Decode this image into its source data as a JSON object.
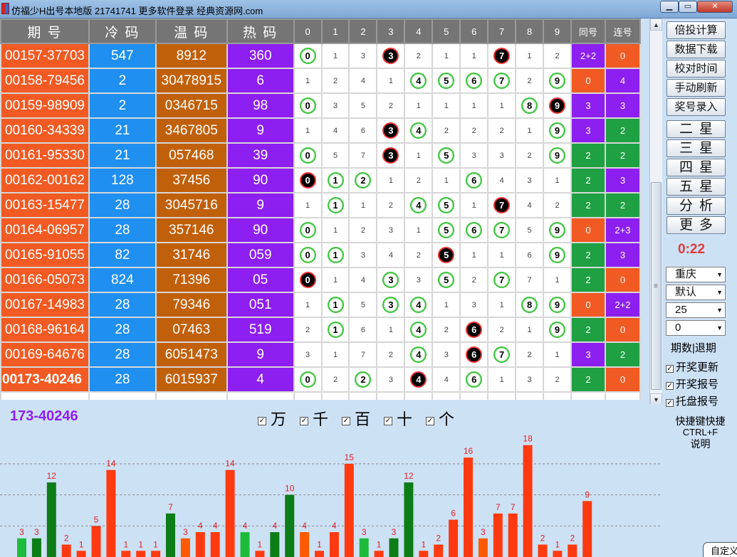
{
  "window": {
    "title": "仿福少H出号本地版 21741741 更多软件登录 经典资源网.com",
    "minimize": "▁",
    "maximize": "▭",
    "close": "✕"
  },
  "table": {
    "headers": [
      "期 号",
      "冷 码",
      "温 码",
      "热 码",
      "0",
      "1",
      "2",
      "3",
      "4",
      "5",
      "6",
      "7",
      "8",
      "9",
      "同号",
      "连号"
    ],
    "rows": [
      {
        "issue": "00157-37703",
        "cold": "547",
        "warm": "8912",
        "hot": "360",
        "digits": [
          {
            "v": "0",
            "s": "g"
          },
          {
            "v": "1"
          },
          {
            "v": "3"
          },
          {
            "v": "3",
            "s": "b"
          },
          {
            "v": "2"
          },
          {
            "v": "1"
          },
          {
            "v": "1"
          },
          {
            "v": "7",
            "s": "b"
          },
          {
            "v": "1"
          },
          {
            "v": "2"
          }
        ],
        "same": "2+2",
        "same_color": "purple",
        "cons": "0",
        "cons_color": "orange"
      },
      {
        "issue": "00158-79456",
        "cold": "2",
        "warm": "30478915",
        "hot": "6",
        "digits": [
          {
            "v": "1"
          },
          {
            "v": "2"
          },
          {
            "v": "4"
          },
          {
            "v": "1"
          },
          {
            "v": "4",
            "s": "g"
          },
          {
            "v": "5",
            "s": "g"
          },
          {
            "v": "6",
            "s": "g"
          },
          {
            "v": "7",
            "s": "g"
          },
          {
            "v": "2"
          },
          {
            "v": "9",
            "s": "g"
          }
        ],
        "same": "0",
        "same_color": "orange",
        "cons": "4",
        "cons_color": "purple"
      },
      {
        "issue": "00159-98909",
        "cold": "2",
        "warm": "0346715",
        "hot": "98",
        "digits": [
          {
            "v": "0",
            "s": "g"
          },
          {
            "v": "3"
          },
          {
            "v": "5"
          },
          {
            "v": "2"
          },
          {
            "v": "1"
          },
          {
            "v": "1"
          },
          {
            "v": "1"
          },
          {
            "v": "1"
          },
          {
            "v": "8",
            "s": "g"
          },
          {
            "v": "9",
            "s": "b"
          }
        ],
        "same": "3",
        "same_color": "purple",
        "cons": "3",
        "cons_color": "purple"
      },
      {
        "issue": "00160-34339",
        "cold": "21",
        "warm": "3467805",
        "hot": "9",
        "digits": [
          {
            "v": "1"
          },
          {
            "v": "4"
          },
          {
            "v": "6"
          },
          {
            "v": "3",
            "s": "b"
          },
          {
            "v": "4",
            "s": "g"
          },
          {
            "v": "2"
          },
          {
            "v": "2"
          },
          {
            "v": "2"
          },
          {
            "v": "1"
          },
          {
            "v": "9",
            "s": "g"
          }
        ],
        "same": "3",
        "same_color": "purple",
        "cons": "2",
        "cons_color": "green"
      },
      {
        "issue": "00161-95330",
        "cold": "21",
        "warm": "057468",
        "hot": "39",
        "digits": [
          {
            "v": "0",
            "s": "g"
          },
          {
            "v": "5"
          },
          {
            "v": "7"
          },
          {
            "v": "3",
            "s": "b"
          },
          {
            "v": "1"
          },
          {
            "v": "5",
            "s": "g"
          },
          {
            "v": "3"
          },
          {
            "v": "3"
          },
          {
            "v": "2"
          },
          {
            "v": "9",
            "s": "g"
          }
        ],
        "same": "2",
        "same_color": "green",
        "cons": "2",
        "cons_color": "green"
      },
      {
        "issue": "00162-00162",
        "cold": "128",
        "warm": "37456",
        "hot": "90",
        "digits": [
          {
            "v": "0",
            "s": "b"
          },
          {
            "v": "1",
            "s": "g"
          },
          {
            "v": "2",
            "s": "g"
          },
          {
            "v": "1"
          },
          {
            "v": "2"
          },
          {
            "v": "1"
          },
          {
            "v": "6",
            "s": "g"
          },
          {
            "v": "4"
          },
          {
            "v": "3"
          },
          {
            "v": "1"
          }
        ],
        "same": "2",
        "same_color": "green",
        "cons": "3",
        "cons_color": "purple"
      },
      {
        "issue": "00163-15477",
        "cold": "28",
        "warm": "3045716",
        "hot": "9",
        "digits": [
          {
            "v": "1"
          },
          {
            "v": "1",
            "s": "g"
          },
          {
            "v": "1"
          },
          {
            "v": "2"
          },
          {
            "v": "4",
            "s": "g"
          },
          {
            "v": "5",
            "s": "g"
          },
          {
            "v": "1"
          },
          {
            "v": "7",
            "s": "b"
          },
          {
            "v": "4"
          },
          {
            "v": "2"
          }
        ],
        "same": "2",
        "same_color": "green",
        "cons": "2",
        "cons_color": "green"
      },
      {
        "issue": "00164-06957",
        "cold": "28",
        "warm": "357146",
        "hot": "90",
        "digits": [
          {
            "v": "0",
            "s": "g"
          },
          {
            "v": "1"
          },
          {
            "v": "2"
          },
          {
            "v": "3"
          },
          {
            "v": "1"
          },
          {
            "v": "5",
            "s": "g"
          },
          {
            "v": "6",
            "s": "g"
          },
          {
            "v": "7",
            "s": "g"
          },
          {
            "v": "5"
          },
          {
            "v": "9",
            "s": "g"
          }
        ],
        "same": "0",
        "same_color": "orange",
        "cons": "2+3",
        "cons_color": "purple"
      },
      {
        "issue": "00165-91055",
        "cold": "82",
        "warm": "31746",
        "hot": "059",
        "digits": [
          {
            "v": "0",
            "s": "g"
          },
          {
            "v": "1",
            "s": "g"
          },
          {
            "v": "3"
          },
          {
            "v": "4"
          },
          {
            "v": "2"
          },
          {
            "v": "5",
            "s": "b"
          },
          {
            "v": "1"
          },
          {
            "v": "1"
          },
          {
            "v": "6"
          },
          {
            "v": "9",
            "s": "g"
          }
        ],
        "same": "2",
        "same_color": "green",
        "cons": "3",
        "cons_color": "purple"
      },
      {
        "issue": "00166-05073",
        "cold": "824",
        "warm": "71396",
        "hot": "05",
        "digits": [
          {
            "v": "0",
            "s": "b"
          },
          {
            "v": "1"
          },
          {
            "v": "4"
          },
          {
            "v": "3",
            "s": "g"
          },
          {
            "v": "3"
          },
          {
            "v": "5",
            "s": "g"
          },
          {
            "v": "2"
          },
          {
            "v": "7",
            "s": "g"
          },
          {
            "v": "7"
          },
          {
            "v": "1"
          }
        ],
        "same": "2",
        "same_color": "green",
        "cons": "0",
        "cons_color": "orange"
      },
      {
        "issue": "00167-14983",
        "cold": "28",
        "warm": "79346",
        "hot": "051",
        "digits": [
          {
            "v": "1"
          },
          {
            "v": "1",
            "s": "g"
          },
          {
            "v": "5"
          },
          {
            "v": "3",
            "s": "g"
          },
          {
            "v": "4",
            "s": "g"
          },
          {
            "v": "1"
          },
          {
            "v": "3"
          },
          {
            "v": "1"
          },
          {
            "v": "8",
            "s": "g"
          },
          {
            "v": "9",
            "s": "g"
          }
        ],
        "same": "0",
        "same_color": "orange",
        "cons": "2+2",
        "cons_color": "purple"
      },
      {
        "issue": "00168-96164",
        "cold": "28",
        "warm": "07463",
        "hot": "519",
        "digits": [
          {
            "v": "2"
          },
          {
            "v": "1",
            "s": "g"
          },
          {
            "v": "6"
          },
          {
            "v": "1"
          },
          {
            "v": "4",
            "s": "g"
          },
          {
            "v": "2"
          },
          {
            "v": "6",
            "s": "b"
          },
          {
            "v": "2"
          },
          {
            "v": "1"
          },
          {
            "v": "9",
            "s": "g"
          }
        ],
        "same": "2",
        "same_color": "green",
        "cons": "0",
        "cons_color": "orange"
      },
      {
        "issue": "00169-64676",
        "cold": "28",
        "warm": "6051473",
        "hot": "9",
        "digits": [
          {
            "v": "3"
          },
          {
            "v": "1"
          },
          {
            "v": "7"
          },
          {
            "v": "2"
          },
          {
            "v": "4",
            "s": "g"
          },
          {
            "v": "3"
          },
          {
            "v": "6",
            "s": "b"
          },
          {
            "v": "7",
            "s": "g"
          },
          {
            "v": "2"
          },
          {
            "v": "1"
          }
        ],
        "same": "3",
        "same_color": "purple",
        "cons": "2",
        "cons_color": "green"
      },
      {
        "issue": "00173-40246",
        "cold": "28",
        "warm": "6015937",
        "hot": "4",
        "digits": [
          {
            "v": "0",
            "s": "g"
          },
          {
            "v": "2"
          },
          {
            "v": "2",
            "s": "g"
          },
          {
            "v": "3"
          },
          {
            "v": "4",
            "s": "b"
          },
          {
            "v": "4"
          },
          {
            "v": "6",
            "s": "g"
          },
          {
            "v": "1"
          },
          {
            "v": "3"
          },
          {
            "v": "2"
          }
        ],
        "same": "2",
        "same_color": "green",
        "cons": "0",
        "cons_color": "orange"
      }
    ]
  },
  "side_panel": {
    "buttons": [
      "倍投计算",
      "数据下载",
      "校对时间",
      "手动刷新",
      "奖号录入"
    ],
    "star_buttons": [
      "二星",
      "三星",
      "四星",
      "五星",
      "分析",
      "更多"
    ],
    "timer": "0:22",
    "selects": [
      "重庆",
      "默认",
      "25",
      "0"
    ],
    "period_label": "期数|退期",
    "checkboxes": [
      "开奖更新",
      "开奖报号",
      "托盘报号"
    ],
    "hint_line1": "快捷键快捷",
    "hint_line2": "CTRL+F",
    "hint_line3": "说明",
    "custom_button": "自定义"
  },
  "chart_area": {
    "current_issue": "173-40246",
    "positions": [
      "万",
      "千",
      "百",
      "十",
      "个"
    ]
  },
  "colors": {
    "issue": "#f15a22",
    "cold": "#1f8ff0",
    "warm": "#c1600a",
    "hot": "#8d1ff0",
    "bar_green": "#0d7d17",
    "bar_red": "#ff3a10",
    "bar_orange": "#ff5a00",
    "bar_lightgreen": "#1dbb3a"
  },
  "chart_data": {
    "type": "bar",
    "values": [
      3,
      3,
      12,
      2,
      1,
      5,
      14,
      1,
      1,
      1,
      7,
      3,
      4,
      4,
      14,
      4,
      1,
      4,
      10,
      4,
      1,
      4,
      15,
      3,
      1,
      3,
      12,
      1,
      2,
      6,
      16,
      3,
      7,
      7,
      18,
      2,
      1,
      2,
      9
    ],
    "bar_colors": [
      "lightgreen",
      "green",
      "green",
      "red",
      "red",
      "red",
      "red",
      "red",
      "red",
      "red",
      "green",
      "orange",
      "red",
      "red",
      "red",
      "lightgreen",
      "red",
      "green",
      "green",
      "orange",
      "red",
      "red",
      "red",
      "lightgreen",
      "red",
      "green",
      "green",
      "red",
      "red",
      "red",
      "red",
      "orange",
      "red",
      "red",
      "red",
      "red",
      "red",
      "red",
      "red"
    ],
    "ylim": [
      0,
      19
    ],
    "grid": "dashed horizontal",
    "title": "",
    "xlabel": "",
    "ylabel": ""
  }
}
